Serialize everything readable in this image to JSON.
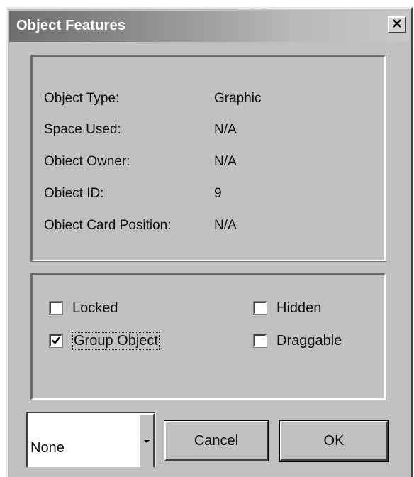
{
  "window": {
    "title": "Object Features",
    "close_icon": "close-icon"
  },
  "info": [
    {
      "label": "Object Type:",
      "value": "Graphic"
    },
    {
      "label": "Space Used:",
      "value": "N/A"
    },
    {
      "label": "Obiect Owner:",
      "value": "N/A"
    },
    {
      "label": "Obiect ID:",
      "value": "9"
    },
    {
      "label": "Obiect Card Position:",
      "value": "N/A"
    }
  ],
  "options": {
    "locked": {
      "label": "Locked",
      "checked": false
    },
    "hidden": {
      "label": "Hidden",
      "checked": false
    },
    "group_object": {
      "label": "Group Object",
      "checked": true
    },
    "draggable": {
      "label": "Draggable",
      "checked": false
    }
  },
  "dropdown": {
    "value": "None",
    "icon": "chevron-down-icon"
  },
  "buttons": {
    "cancel": "Cancel",
    "ok": "OK"
  }
}
